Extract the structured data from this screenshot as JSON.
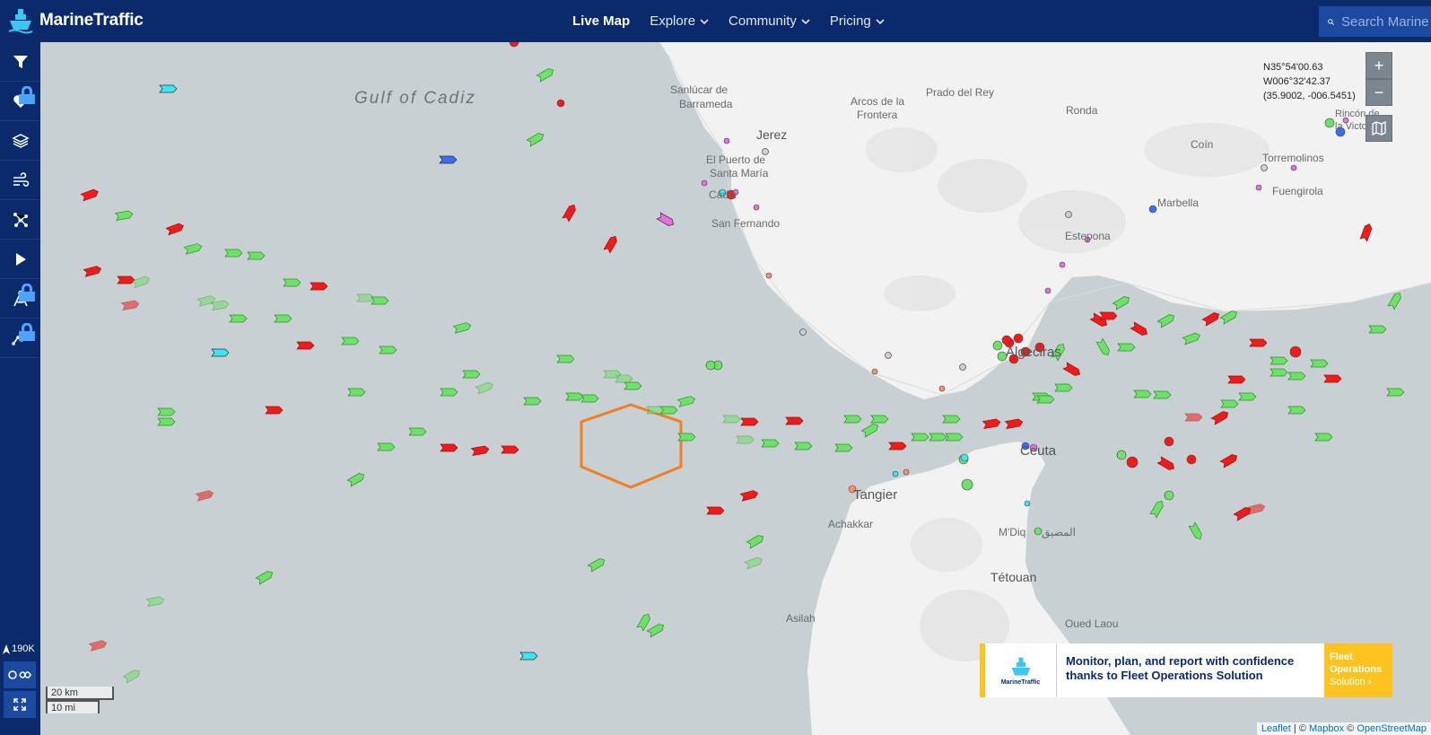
{
  "header": {
    "brand": "MarineTraffic",
    "nav": [
      {
        "label": "Live Map",
        "active": true,
        "dropdown": false
      },
      {
        "label": "Explore",
        "active": false,
        "dropdown": true
      },
      {
        "label": "Community",
        "active": false,
        "dropdown": true
      },
      {
        "label": "Pricing",
        "active": false,
        "dropdown": true
      }
    ],
    "search_placeholder": "Search Marine"
  },
  "sidebar": {
    "items": [
      "filter-icon",
      "heart-icon",
      "layers-icon",
      "wind-icon",
      "network-icon",
      "play-icon",
      "compass-icon",
      "chart-line-icon"
    ],
    "vessel_count": "190K"
  },
  "map": {
    "coords": {
      "lat": "N35°54'00.63",
      "lon": "W006°32'42.37",
      "decimal": "(35.9002, -006.5451)"
    },
    "zoom_in": "+",
    "zoom_out": "−",
    "labels": {
      "gulf": "Gulf of Cadiz",
      "sanlucar": "Sanlúcar de",
      "barrameda": "Barrameda",
      "jerez": "Jerez",
      "puerto": "El Puerto de",
      "santa_maria": "Santa María",
      "cadiz": "Cádiz",
      "san_fernando": "San Fernando",
      "arcos1": "Arcos de la",
      "arcos2": "Frontera",
      "prado": "Prado del Rey",
      "ronda": "Ronda",
      "coin": "Coín",
      "rincon1": "Rincón de",
      "rincon2": "la Victoria",
      "torremolinos": "Torremolinos",
      "fuengirola": "Fuengirola",
      "marbella": "Marbella",
      "estepona": "Estepona",
      "algeciras": "Algeciras",
      "ceuta": "Ceuta",
      "tangier": "Tangier",
      "achakkar": "Achakkar",
      "mdiq": "M'Diq",
      "mdiq_ar": "المضيق",
      "tetouan": "Tétouan",
      "asilah": "Asilah",
      "oued_laou": "Oued Laou"
    },
    "scale": {
      "km": "20 km",
      "mi": "10 mi"
    },
    "attribution": {
      "leaflet": "Leaflet",
      "sep": " | © ",
      "mapbox": "Mapbox",
      "osm_prefix": " © ",
      "osm": "OpenStreetMap"
    }
  },
  "ad": {
    "logo_text": "MarineTraffic",
    "line1": "Monitor, plan, and report with confidence",
    "line2": "thanks to Fleet Operations Solution",
    "cta_title1": "Fleet",
    "cta_title2": "Operations",
    "cta_sub": "Solution"
  },
  "colors": {
    "navbar": "#0a2a6b",
    "sea": "#c9d0d3",
    "land": "#f2f2f2",
    "cargo": "#6fe06a",
    "tanker": "#f21b1b",
    "passenger": "#3a6df0",
    "fishing": "#ff8f6b",
    "pleasure": "#e96ee0",
    "tug": "#3ae6f0",
    "polygon": "#f07f24",
    "ad_accent": "#ffc31f"
  }
}
